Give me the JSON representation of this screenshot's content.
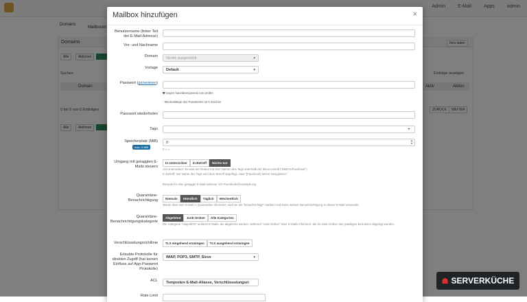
{
  "background": {
    "topnav": [
      "Admin",
      "E-Mail",
      "Apps",
      "admin"
    ],
    "domains_tab": "Domains",
    "mailbox_tab": "Mailboxen",
    "panel_title": "Domains",
    "reload": "Neu laden",
    "all": "Alle",
    "actions": "Aktionen",
    "search": "Suchen",
    "show_entries": "Einträge anzeigen",
    "col_domain": "Domain",
    "col_active": "Aktiv",
    "col_action": "Aktion",
    "info": "0 bis 0 von 0 Einträgen",
    "prev": "ZURÜCK",
    "next": "WEITER"
  },
  "modal": {
    "title": "Mailbox hinzufügen",
    "close": "×",
    "fields": {
      "username_label": "Benutzername (linker Teil der E-Mail-Adresse)",
      "fullname_label": "Vor- und Nachname",
      "domain_label": "Domain",
      "domain_value": "Nichts ausgewählt",
      "template_label": "Vorlage",
      "template_value": "Default",
      "password_label": "Passwort (",
      "password_generate": "generieren",
      "password_label_end": ")",
      "pwned_check": "Gegen haveibeenpwned.com prüfen",
      "password_min": "- Mindestlänge des Passwortes ist 6 Zeichen",
      "password_repeat_label": "Passwort wiederholen",
      "tags_label": "Tags",
      "tags_plus": "+",
      "quota_label": "Speicherplatz (MiB)",
      "quota_badge": "max. 0 MiB",
      "quota_value": "0",
      "quota_hint": "0 = ∞",
      "tagged_label": "Umgang mit getaggten E-Mails steuern",
      "tagged_options": [
        "In Unterordner",
        "In Betreff",
        "Nichts tun"
      ],
      "tagged_help1": "Als Unterordner: Es wird ein Ordner mit dem Namen des Tags unterhalb der Inbox erstellt (\"INBOX/Facebook\").",
      "tagged_help2": "In Betreff: Der Name des Tags wird dem Betreff angefügt, etwa \"[Facebook] Meine Neuigkeiten\".",
      "tagged_example": "Beispiel für eine getaggte E-Mail-Adresse: ich+Facebook@example.org",
      "quarantine_label": "Quarantäne-Benachrichtigung",
      "quarantine_options": [
        "Niemals",
        "Stündlich",
        "Täglich",
        "Wöchentlich"
      ],
      "quarantine_help": "Wurde über eine E-Mail in Quarantäne informiert, wird sie als \"benachrichtigt\" markiert und keine weitere Benachrichtigung zu dieser E-Mail versendet.",
      "quarantine_cat_label": "Quarantäne-Benachrichtigungskategorie",
      "quarantine_cat_options": [
        "Abgelehnt",
        "Junk-Ordner",
        "Alle Kategorien"
      ],
      "quarantine_cat_help": "Die Kategorie \"Abgelehnt\" umfasst E-Mails, die abgelehnt wurden, während \"Junk-Ordner\" über E-Mails informiert, die im Junk-Ordner des jeweiligen Benutzers abgelegt wurden.",
      "encryption_label": "Verschlüsselungsrichtlinie",
      "encryption_options": [
        "TLS eingehend erzwingen",
        "TLS ausgehend erzwingen"
      ],
      "protocols_label": "Erlaubte Protokolle für direkten Zugriff (hat keinen Einfluss auf App-Passwort Protokolle)",
      "protocols_value": "IMAP, POP3, SMTP, Sieve",
      "acl_label": "ACL",
      "acl_value": "Temporäre E-Mail-Aliasse, Verschlüsselungsri·",
      "rate_label": "Rate Limit"
    }
  },
  "watermark": "SERVERKÜCHE",
  "colors": {
    "active_button": "#555555",
    "badge": "#1e6fa3",
    "watermark_bg": "#1f2326",
    "watermark_icon": "#d9302c"
  }
}
